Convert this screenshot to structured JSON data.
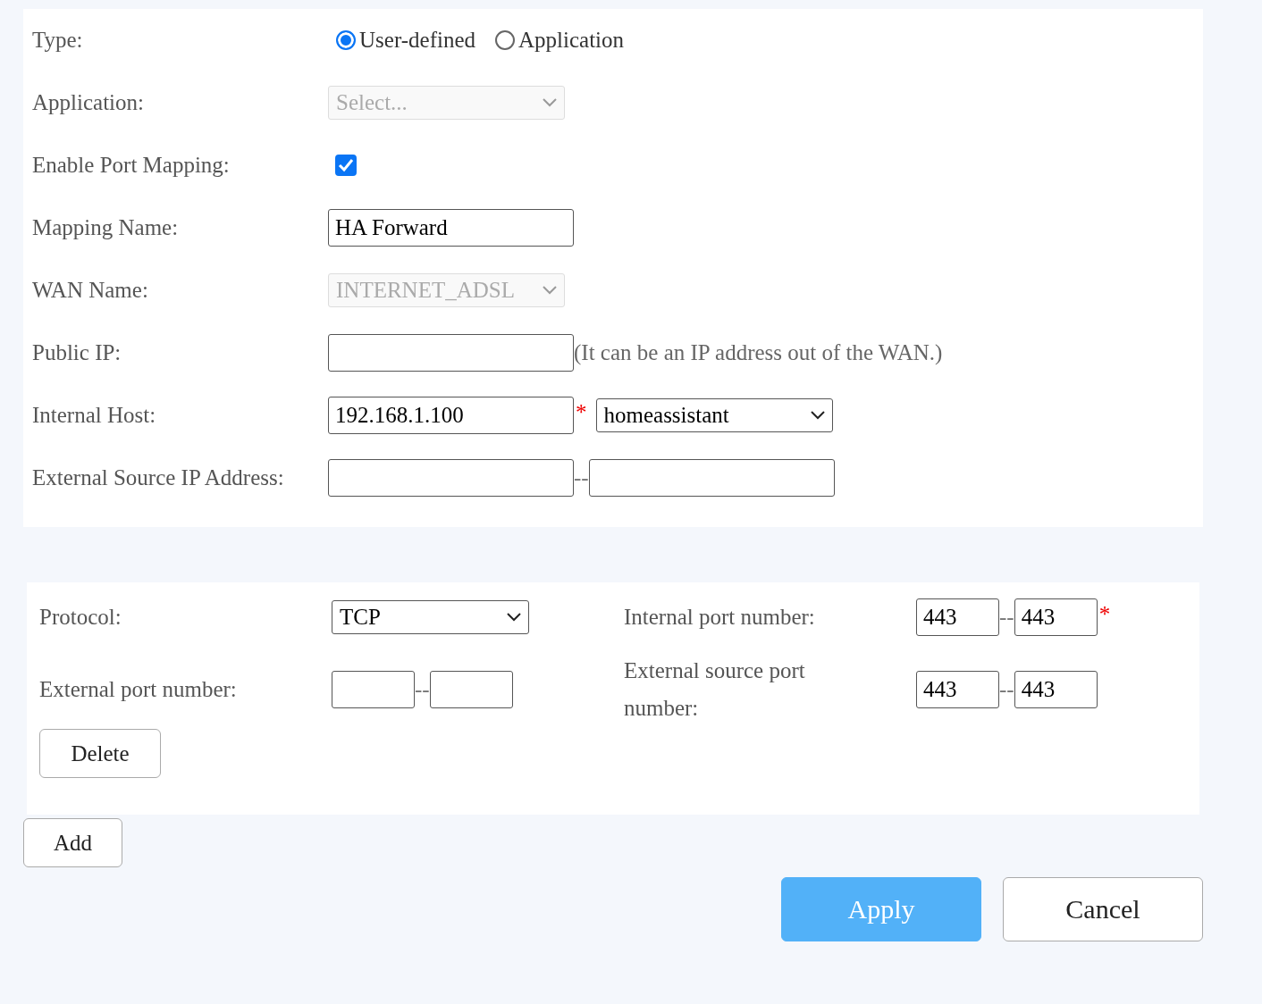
{
  "general": {
    "type_row": {
      "label": "Type:",
      "options": [
        {
          "label": "User-defined",
          "selected": true
        },
        {
          "label": "Application",
          "selected": false
        }
      ]
    },
    "application": {
      "label": "Application:",
      "value": "Select...",
      "disabled": true
    },
    "enable_port_mapping": {
      "label": "Enable Port Mapping:",
      "checked": true
    },
    "mapping_name": {
      "label": "Mapping Name:",
      "value": "HA Forward"
    },
    "wan_name": {
      "label": "WAN Name:",
      "value": "INTERNET_ADSL",
      "disabled": true
    },
    "public_ip": {
      "label": "Public IP:",
      "hint": "(It can be an IP address out of the WAN.)"
    },
    "internal_host": {
      "label": "Internal Host:",
      "value": "192.168.1.100",
      "required_mark": "*",
      "host_select": "homeassistant"
    },
    "external_source_ip": {
      "label": "External Source IP Address:",
      "separator": "--"
    }
  },
  "port_rules": [
    {
      "protocol": {
        "label": "Protocol:",
        "value": "TCP"
      },
      "internal_port": {
        "label": "Internal port number:",
        "from": "443",
        "separator": "--",
        "to": "443",
        "required_mark": "*"
      },
      "external_port": {
        "label": "External port number:",
        "separator": "--"
      },
      "external_source_port": {
        "label": "External source port number:",
        "from": "443",
        "separator": "--",
        "to": "443"
      },
      "delete_button": "Delete"
    }
  ],
  "add_button": "Add",
  "buttons": [
    {
      "label": "Apply",
      "kind": "primary"
    },
    {
      "label": "Cancel",
      "kind": "secondary"
    }
  ]
}
